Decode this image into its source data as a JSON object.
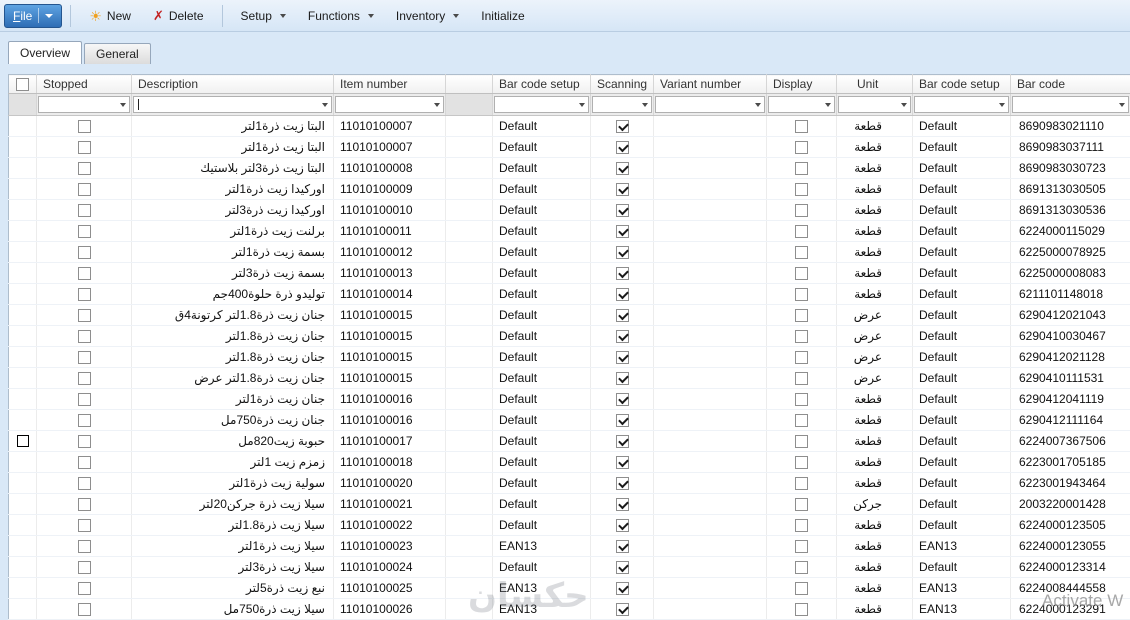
{
  "toolbar": {
    "file_label_first": "F",
    "file_label_rest": "ile",
    "new_label": "New",
    "delete_label": "Delete",
    "setup_label": "Setup",
    "functions_label": "Functions",
    "inventory_label": "Inventory",
    "initialize_label": "Initialize"
  },
  "tabs": {
    "overview": "Overview",
    "general": "General"
  },
  "grid": {
    "columns": {
      "stopped": "Stopped",
      "description": "Description",
      "item_number": "Item number",
      "barcode_setup": "Bar code setup",
      "scanning": "Scanning",
      "variant_number": "Variant number",
      "display": "Display",
      "unit": "Unit",
      "barcode_setup2": "Bar code setup",
      "barcode": "Bar code"
    },
    "rows": [
      {
        "stopped": false,
        "desc": "البتا زيت ذرة1لتر",
        "item": "11010100007",
        "setup": "Default",
        "scanning": true,
        "variant": "",
        "display": false,
        "unit": "قطعة",
        "setup2": "Default",
        "barcode": "8690983021110",
        "selected": false
      },
      {
        "stopped": false,
        "desc": "البتا زيت ذرة1لتر",
        "item": "11010100007",
        "setup": "Default",
        "scanning": true,
        "variant": "",
        "display": false,
        "unit": "قطعة",
        "setup2": "Default",
        "barcode": "8690983037111",
        "selected": false
      },
      {
        "stopped": false,
        "desc": "البتا زيت ذرة3لتر بلاستيك",
        "item": "11010100008",
        "setup": "Default",
        "scanning": true,
        "variant": "",
        "display": false,
        "unit": "قطعة",
        "setup2": "Default",
        "barcode": "8690983030723",
        "selected": false
      },
      {
        "stopped": false,
        "desc": "اوركيدا زيت ذرة1لتر",
        "item": "11010100009",
        "setup": "Default",
        "scanning": true,
        "variant": "",
        "display": false,
        "unit": "قطعة",
        "setup2": "Default",
        "barcode": "8691313030505",
        "selected": false
      },
      {
        "stopped": false,
        "desc": "اوركيدا زيت ذرة3لتر",
        "item": "11010100010",
        "setup": "Default",
        "scanning": true,
        "variant": "",
        "display": false,
        "unit": "قطعة",
        "setup2": "Default",
        "barcode": "8691313030536",
        "selected": false
      },
      {
        "stopped": false,
        "desc": "برلنت زيت ذرة1لتر",
        "item": "11010100011",
        "setup": "Default",
        "scanning": true,
        "variant": "",
        "display": false,
        "unit": "قطعة",
        "setup2": "Default",
        "barcode": "6224000115029",
        "selected": false
      },
      {
        "stopped": false,
        "desc": "بسمة زيت ذرة1لتر",
        "item": "11010100012",
        "setup": "Default",
        "scanning": true,
        "variant": "",
        "display": false,
        "unit": "قطعة",
        "setup2": "Default",
        "barcode": "6225000078925",
        "selected": false
      },
      {
        "stopped": false,
        "desc": "بسمة زيت ذرة3لتر",
        "item": "11010100013",
        "setup": "Default",
        "scanning": true,
        "variant": "",
        "display": false,
        "unit": "قطعة",
        "setup2": "Default",
        "barcode": "6225000008083",
        "selected": false
      },
      {
        "stopped": false,
        "desc": "توليدو ذرة حلوة400جم",
        "item": "11010100014",
        "setup": "Default",
        "scanning": true,
        "variant": "",
        "display": false,
        "unit": "قطعة",
        "setup2": "Default",
        "barcode": "6211101148018",
        "selected": false
      },
      {
        "stopped": false,
        "desc": "جنان زيت ذرة1.8لتر كرتونة4ق",
        "item": "11010100015",
        "setup": "Default",
        "scanning": true,
        "variant": "",
        "display": false,
        "unit": "عرض",
        "setup2": "Default",
        "barcode": "6290412021043",
        "selected": false
      },
      {
        "stopped": false,
        "desc": "جنان زيت ذرة1.8لتر",
        "item": "11010100015",
        "setup": "Default",
        "scanning": true,
        "variant": "",
        "display": false,
        "unit": "عرض",
        "setup2": "Default",
        "barcode": "6290410030467",
        "selected": false
      },
      {
        "stopped": false,
        "desc": "جنان زيت ذرة1.8لتر",
        "item": "11010100015",
        "setup": "Default",
        "scanning": true,
        "variant": "",
        "display": false,
        "unit": "عرض",
        "setup2": "Default",
        "barcode": "6290412021128",
        "selected": false
      },
      {
        "stopped": false,
        "desc": "جنان زيت ذرة1.8لتر عرض",
        "item": "11010100015",
        "setup": "Default",
        "scanning": true,
        "variant": "",
        "display": false,
        "unit": "عرض",
        "setup2": "Default",
        "barcode": "6290410111531",
        "selected": false
      },
      {
        "stopped": false,
        "desc": "جنان زيت ذرة1لتر",
        "item": "11010100016",
        "setup": "Default",
        "scanning": true,
        "variant": "",
        "display": false,
        "unit": "قطعة",
        "setup2": "Default",
        "barcode": "6290412041119",
        "selected": false
      },
      {
        "stopped": false,
        "desc": "جنان زيت ذرة750مل",
        "item": "11010100016",
        "setup": "Default",
        "scanning": true,
        "variant": "",
        "display": false,
        "unit": "قطعة",
        "setup2": "Default",
        "barcode": "6290412111164",
        "selected": false
      },
      {
        "stopped": false,
        "desc": "حبوبة زيت820مل",
        "item": "11010100017",
        "setup": "Default",
        "scanning": true,
        "variant": "",
        "display": false,
        "unit": "قطعة",
        "setup2": "Default",
        "barcode": "6224007367506",
        "selected": true
      },
      {
        "stopped": false,
        "desc": "زمزم زيت 1لتر",
        "item": "11010100018",
        "setup": "Default",
        "scanning": true,
        "variant": "",
        "display": false,
        "unit": "قطعة",
        "setup2": "Default",
        "barcode": "6223001705185",
        "selected": false
      },
      {
        "stopped": false,
        "desc": "سولية زيت ذرة1لتر",
        "item": "11010100020",
        "setup": "Default",
        "scanning": true,
        "variant": "",
        "display": false,
        "unit": "قطعة",
        "setup2": "Default",
        "barcode": "6223001943464",
        "selected": false
      },
      {
        "stopped": false,
        "desc": "سيلا زيت ذرة جركن20لتر",
        "item": "11010100021",
        "setup": "Default",
        "scanning": true,
        "variant": "",
        "display": false,
        "unit": "جركن",
        "setup2": "Default",
        "barcode": "2003220001428",
        "selected": false
      },
      {
        "stopped": false,
        "desc": "سيلا زيت ذرة1.8لتر",
        "item": "11010100022",
        "setup": "Default",
        "scanning": true,
        "variant": "",
        "display": false,
        "unit": "قطعة",
        "setup2": "Default",
        "barcode": "6224000123505",
        "selected": false
      },
      {
        "stopped": false,
        "desc": "سيلا زيت ذرة1لتر",
        "item": "11010100023",
        "setup": "EAN13",
        "scanning": true,
        "variant": "",
        "display": false,
        "unit": "قطعة",
        "setup2": "EAN13",
        "barcode": "6224000123055",
        "selected": false
      },
      {
        "stopped": false,
        "desc": "سيلا زيت ذرة3لتر",
        "item": "11010100024",
        "setup": "Default",
        "scanning": true,
        "variant": "",
        "display": false,
        "unit": "قطعة",
        "setup2": "Default",
        "barcode": "6224000123314",
        "selected": false
      },
      {
        "stopped": false,
        "desc": "نبع زيت ذرة5لتر",
        "item": "11010100025",
        "setup": "EAN13",
        "scanning": true,
        "variant": "",
        "display": false,
        "unit": "قطعة",
        "setup2": "EAN13",
        "barcode": "6224008444558",
        "selected": false
      },
      {
        "stopped": false,
        "desc": "سيلا زيت ذرة750مل",
        "item": "11010100026",
        "setup": "EAN13",
        "scanning": true,
        "variant": "",
        "display": false,
        "unit": "قطعة",
        "setup2": "EAN13",
        "barcode": "6224000123291",
        "selected": false
      }
    ]
  },
  "watermarks": {
    "center": "حكسان",
    "activate": "Activate W"
  }
}
